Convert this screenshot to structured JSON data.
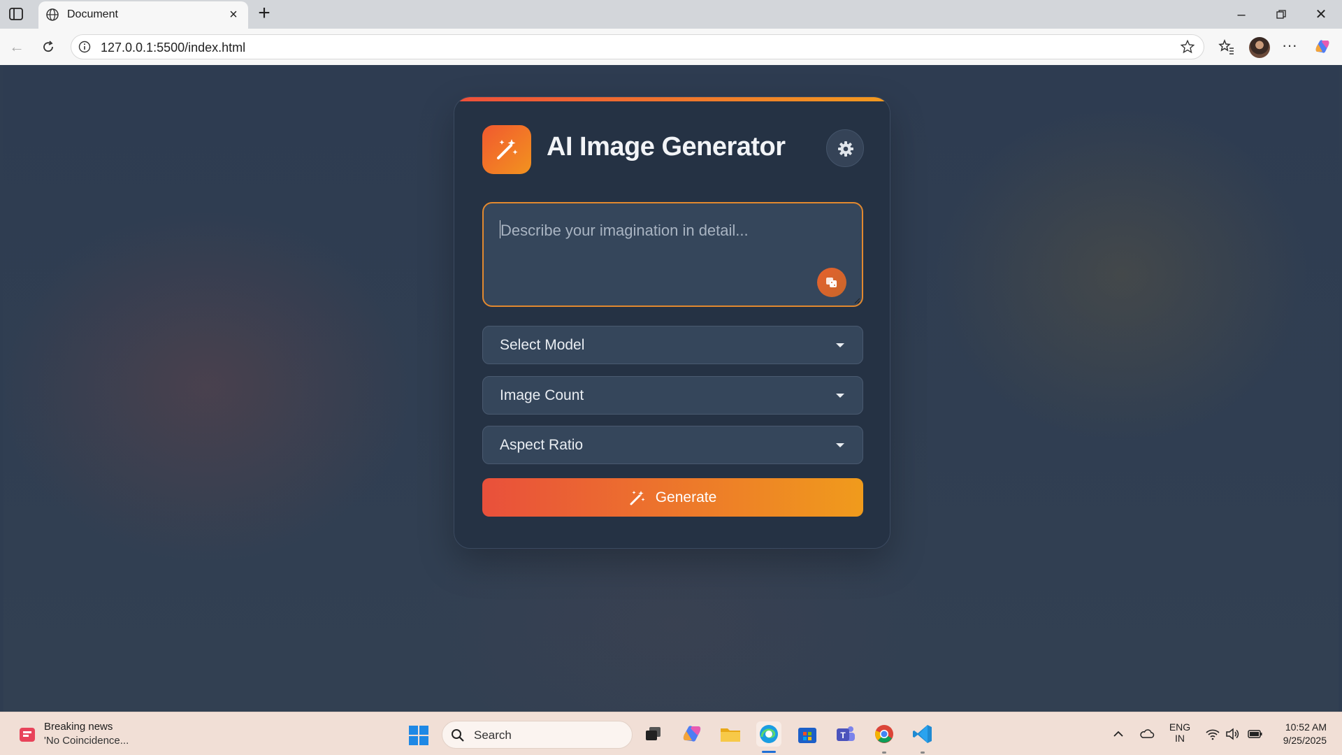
{
  "browser": {
    "tab_title": "Document",
    "url": "127.0.0.1:5500/index.html"
  },
  "app": {
    "title": "AI Image Generator",
    "prompt_placeholder": "Describe your imagination in detail...",
    "selects": [
      {
        "label": "Select Model"
      },
      {
        "label": "Image Count"
      },
      {
        "label": "Aspect Ratio"
      }
    ],
    "generate_label": "Generate",
    "colors": {
      "accent_start": "#ef4f3a",
      "accent_end": "#f29a1f",
      "card_bg": "#253244",
      "page_bg": "#2f3d51"
    },
    "icons": {
      "logo": "magic-wand-icon",
      "settings": "gear-icon",
      "prompt_action": "dice-icon",
      "generate": "magic-wand-icon"
    }
  },
  "taskbar": {
    "news_title": "Breaking news",
    "news_subtitle": "'No Coincidence...",
    "search_label": "Search",
    "lang_line1": "ENG",
    "lang_line2": "IN",
    "time": "10:52 AM",
    "date": "9/25/2025"
  }
}
